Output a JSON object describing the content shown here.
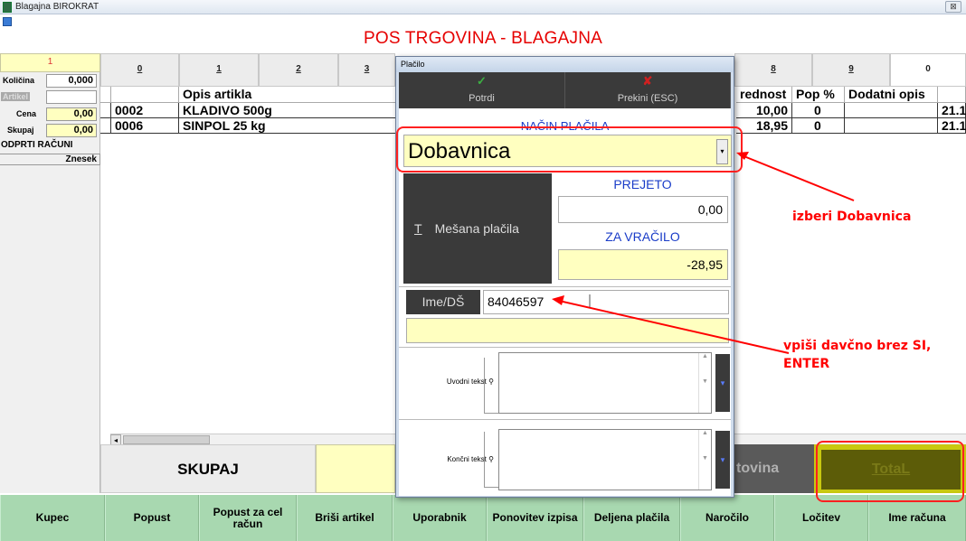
{
  "window": {
    "title": "Blagajna BIROKRAT",
    "close_label": "⊠"
  },
  "header": {
    "title": "POS TRGOVINA - BLAGAJNA"
  },
  "left_panel": {
    "top_number": "1",
    "kolicina_label": "Količina",
    "kolicina_value": "0,000",
    "artikel_label": "Artikel",
    "artikel_value": "",
    "cena_label": "Cena",
    "cena_value": "0,00",
    "skupaj_label": "Skupaj",
    "skupaj_value": "0,00",
    "odprti_label": "ODPRTI RAČUNI",
    "znesek_label": "Znesek"
  },
  "tabs": [
    "0",
    "1",
    "2",
    "3",
    "8",
    "9",
    "0"
  ],
  "grid": {
    "headers": {
      "opis": "Opis artikla",
      "vrednost": "rednost",
      "popust": "Pop %",
      "dodatni": "Dodatni opis"
    },
    "rows": [
      {
        "sifra": "0002",
        "opis": "KLADIVO 500g",
        "vrednost": "10,00",
        "popust": "0",
        "extra": "21.1"
      },
      {
        "sifra": "0006",
        "opis": "SINPOL 25 kg",
        "vrednost": "18,95",
        "popust": "0",
        "extra": "21.1"
      }
    ]
  },
  "bottom": {
    "skupaj_label": "SKUPAJ",
    "gotovina_label": "tovina",
    "total_label": "TotaL"
  },
  "bottom_bar": [
    {
      "label": "Kupec"
    },
    {
      "label": "Popust"
    },
    {
      "label": "Popust za cel račun"
    },
    {
      "label": "Briši artikel"
    },
    {
      "label": "Uporabnik"
    },
    {
      "label": "Ponovitev izpisa"
    },
    {
      "label": "Deljena plačila"
    },
    {
      "label": "Naročilo"
    },
    {
      "label": "Ločitev"
    },
    {
      "label": "Ime računa"
    }
  ],
  "dialog": {
    "title": "Plačilo",
    "potrdi_label": "Potrdi",
    "prekini_label": "Prekini (ESC)",
    "nacin_label": "NAČIN PLAČILA",
    "nacin_value": "Dobavnica",
    "mesana_key": "T",
    "mesana_label": "Mešana plačila",
    "prejeto_label": "PREJETO",
    "prejeto_value": "0,00",
    "zavracilo_label": "ZA VRAČILO",
    "zavracilo_value": "-28,95",
    "imeds_label": "Ime/DŠ",
    "imeds_value": "84046597",
    "uvodni_label": "Uvodni tekst",
    "koncni_label": "Končni tekst"
  },
  "annotations": {
    "a1": "izberi Dobavnica",
    "a2_line1": "vpiši davčno brez SI,",
    "a2_line2": "ENTER"
  },
  "colors": {
    "accent_red": "#ff0000",
    "title_red": "#e60000",
    "field_yellow": "#ffffc0",
    "button_green": "#a8d8b0",
    "label_blue": "#1a3cc8"
  }
}
